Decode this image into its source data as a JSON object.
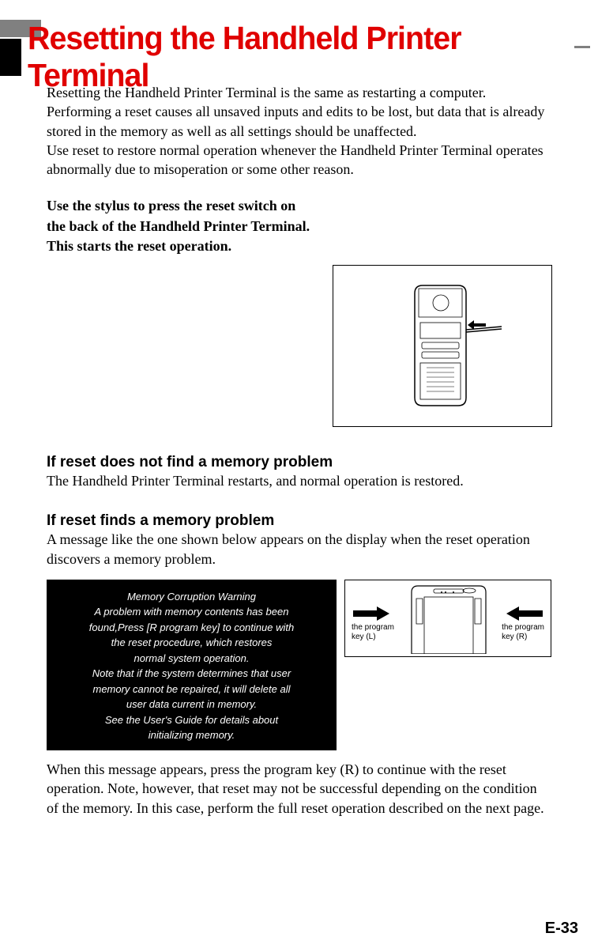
{
  "title": "Resetting the Handheld Printer Terminal",
  "intro": {
    "p1": "Resetting the Handheld Printer Terminal is the same as restarting a computer. Performing a reset causes all unsaved inputs and edits to be lost, but data that is already stored in the memory as well as all settings should be unaffected.",
    "p2": "Use reset to restore normal operation whenever the Handheld Printer Terminal operates abnormally due to misoperation or some other reason."
  },
  "instruction": "Use the stylus to press the reset switch on the back of the Handheld Printer Terminal.\nThis starts the reset operation.",
  "section1": {
    "heading": "If reset does not find a memory problem",
    "body": "The Handheld Printer Terminal restarts, and normal operation is restored."
  },
  "section2": {
    "heading": "If reset finds a memory problem",
    "body": "A message like the one shown below appears on the display when the reset operation discovers a memory problem."
  },
  "warning": {
    "l1": "Memory Corruption Warning",
    "l2": "A problem with memory contents has been",
    "l3": "found,Press [R program key] to continue with",
    "l4": "the reset procedure, which restores",
    "l5": "normal system operation.",
    "l6": "Note that if the system determines that user",
    "l7": "memory cannot be repaired, it will delete all",
    "l8": "user data current in memory.",
    "l9": "See the User's Guide for details about",
    "l10": "initializing memory."
  },
  "keyLabels": {
    "left1": "the program",
    "left2": "key (L)",
    "right1": "the program",
    "right2": "key (R)"
  },
  "closing": "When this message appears, press the program key (R) to continue with the reset operation.  Note, however, that reset may not be successful depending on the condition of the memory.  In this case, perform the full reset operation described on the next page.",
  "pageNum": "E-33"
}
